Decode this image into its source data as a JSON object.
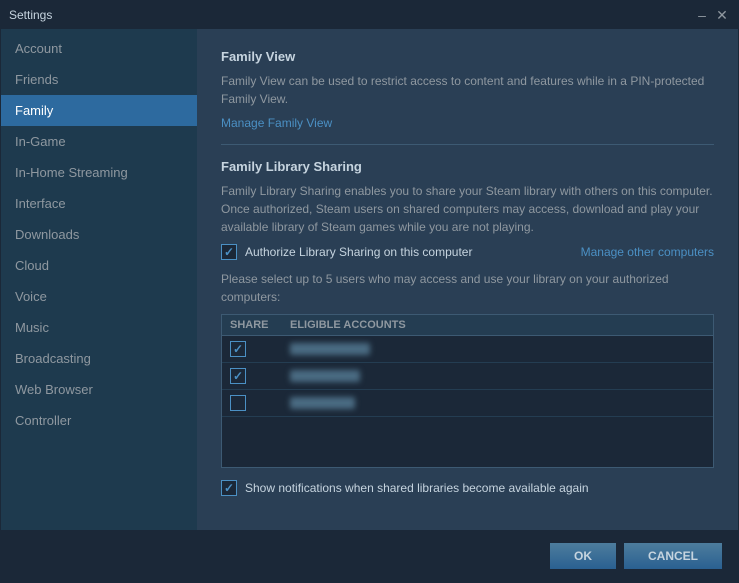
{
  "window": {
    "title": "Settings",
    "minimize_label": "–",
    "close_label": "✕"
  },
  "sidebar": {
    "items": [
      {
        "id": "account",
        "label": "Account"
      },
      {
        "id": "friends",
        "label": "Friends"
      },
      {
        "id": "family",
        "label": "Family"
      },
      {
        "id": "in-game",
        "label": "In-Game"
      },
      {
        "id": "in-home-streaming",
        "label": "In-Home Streaming"
      },
      {
        "id": "interface",
        "label": "Interface"
      },
      {
        "id": "downloads",
        "label": "Downloads"
      },
      {
        "id": "cloud",
        "label": "Cloud"
      },
      {
        "id": "voice",
        "label": "Voice"
      },
      {
        "id": "music",
        "label": "Music"
      },
      {
        "id": "broadcasting",
        "label": "Broadcasting"
      },
      {
        "id": "web-browser",
        "label": "Web Browser"
      },
      {
        "id": "controller",
        "label": "Controller"
      }
    ]
  },
  "main": {
    "family_view_title": "Family View",
    "family_view_desc": "Family View can be used to restrict access to content and features while in a PIN-protected Family View.",
    "manage_family_view_link": "Manage Family View",
    "library_sharing_title": "Family Library Sharing",
    "library_sharing_desc": "Family Library Sharing enables you to share your Steam library with others on this computer. Once authorized, Steam users on shared computers may access, download and play your available library of Steam games while you are not playing.",
    "authorize_label": "Authorize Library Sharing on this computer",
    "manage_other_computers_link": "Manage other computers",
    "eligible_accounts_desc": "Please select up to 5 users who may access and use your library on your authorized computers:",
    "table_headers": {
      "share": "SHARE",
      "accounts": "ELIGIBLE ACCOUNTS"
    },
    "table_rows": [
      {
        "checked": true,
        "name": "account1"
      },
      {
        "checked": true,
        "name": "account2"
      },
      {
        "checked": false,
        "name": "account3"
      }
    ],
    "notify_label": "Show notifications when shared libraries become available again"
  },
  "footer": {
    "ok_label": "OK",
    "cancel_label": "CANCEL"
  }
}
